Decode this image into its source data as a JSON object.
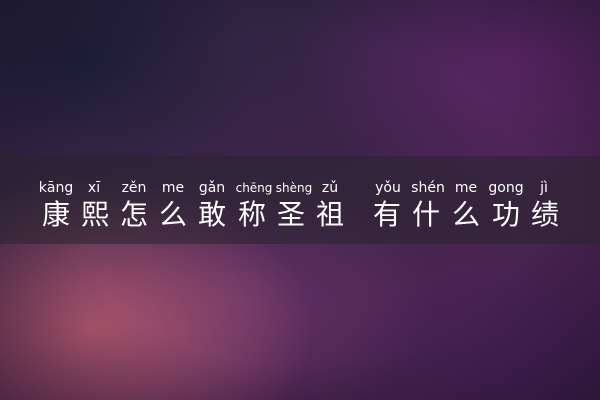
{
  "title": {
    "characters": [
      {
        "hanzi": "康",
        "pinyin": "kāng"
      },
      {
        "hanzi": "熙",
        "pinyin": "xī"
      },
      {
        "hanzi": "怎",
        "pinyin": "zěn"
      },
      {
        "hanzi": "么",
        "pinyin": "me"
      },
      {
        "hanzi": "敢",
        "pinyin": "gǎn"
      },
      {
        "hanzi": "称",
        "pinyin": "chēng"
      },
      {
        "hanzi": "圣",
        "pinyin": "shèng"
      },
      {
        "hanzi": "祖",
        "pinyin": "zǔ"
      },
      {
        "hanzi": "有",
        "pinyin": "yǒu"
      },
      {
        "hanzi": "什",
        "pinyin": "shén"
      },
      {
        "hanzi": "么",
        "pinyin": "me"
      },
      {
        "hanzi": "功",
        "pinyin": "gong"
      },
      {
        "hanzi": "绩",
        "pinyin": "jì"
      }
    ]
  }
}
